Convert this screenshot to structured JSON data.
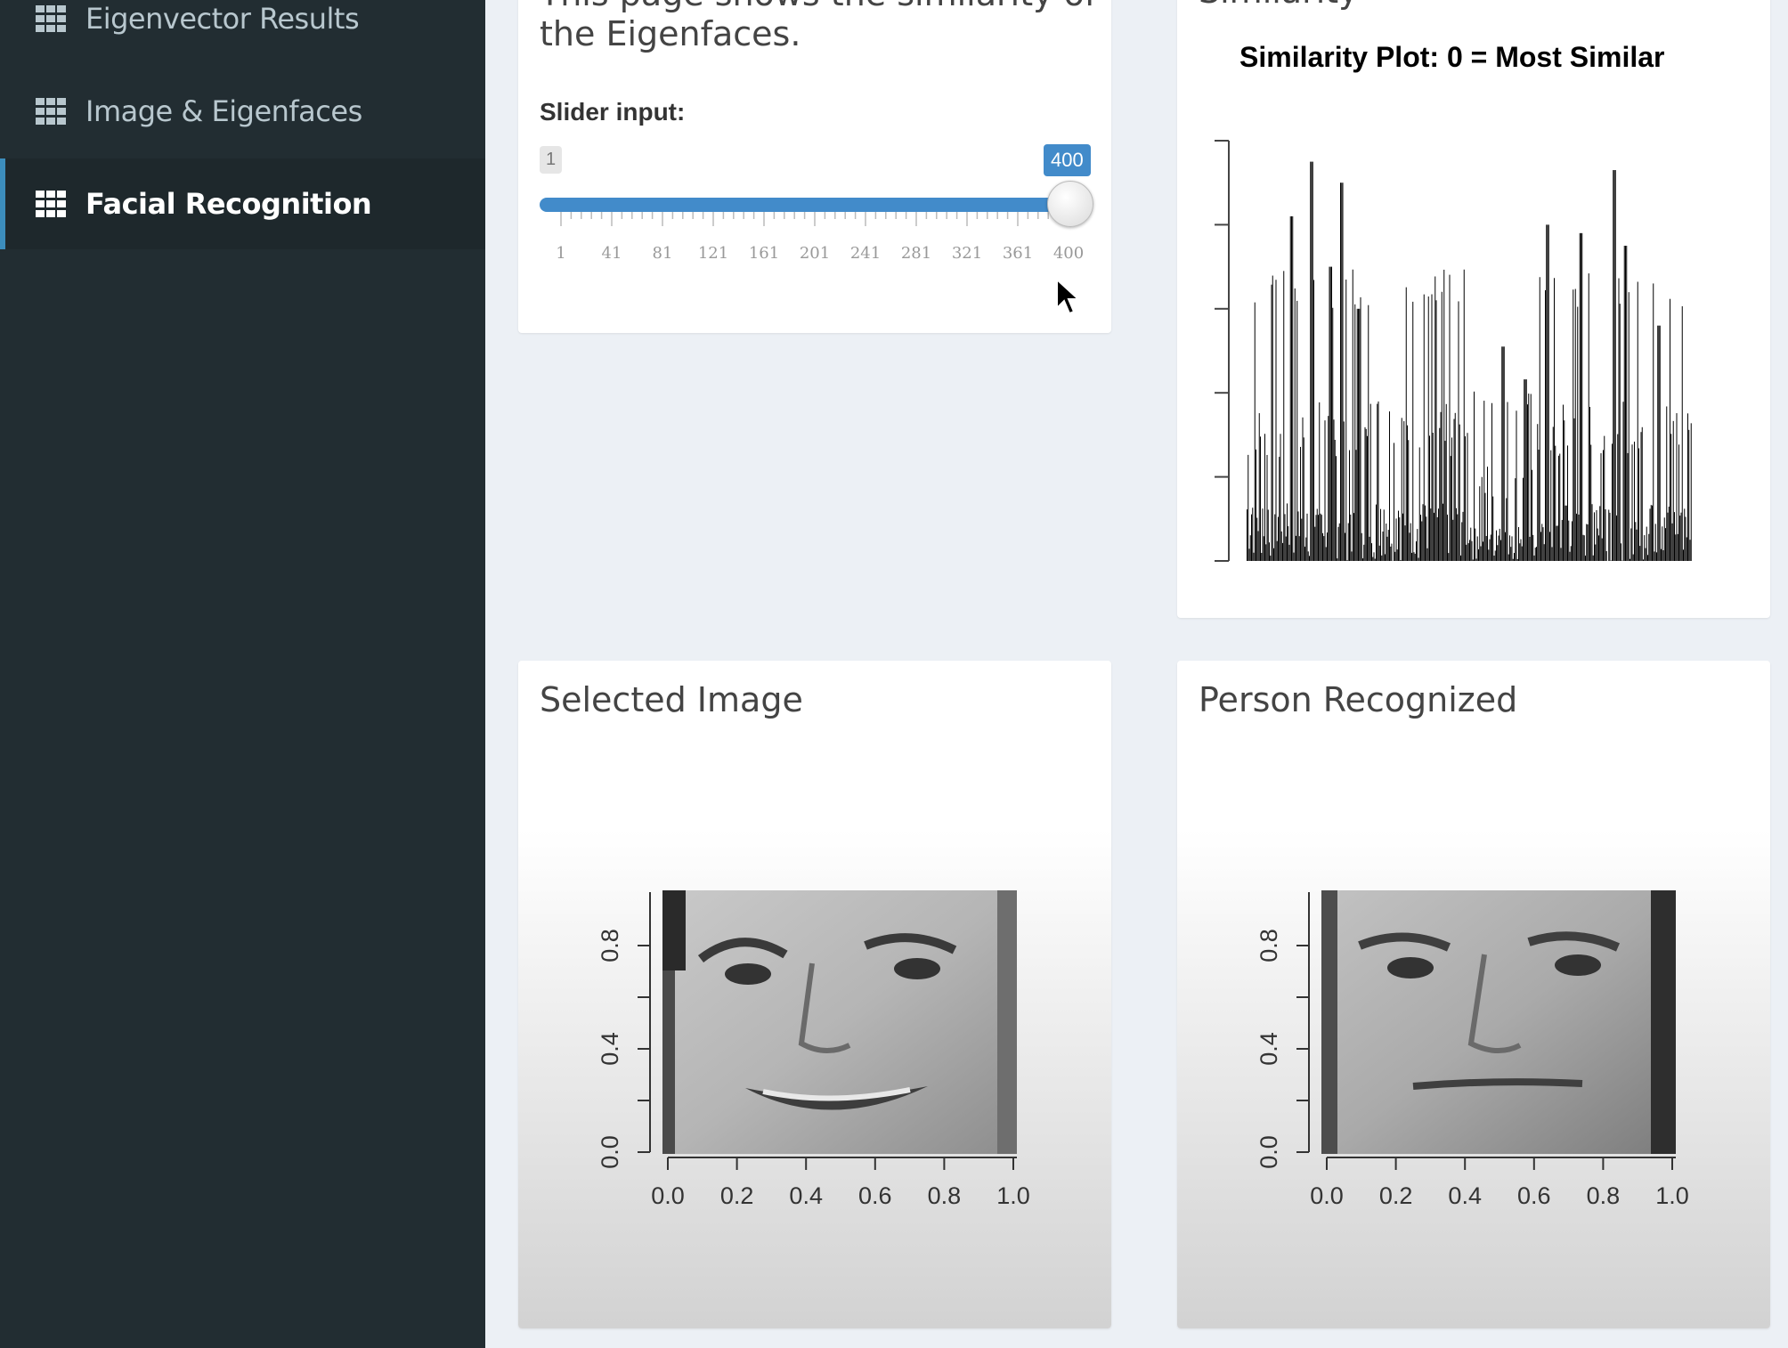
{
  "sidebar": {
    "items": [
      {
        "label": "Eigenvector Results",
        "icon": "grid-icon",
        "active": false
      },
      {
        "label": "Image & Eigenfaces",
        "icon": "grid-icon",
        "active": false
      },
      {
        "label": "Facial Recognition",
        "icon": "grid-icon",
        "active": true
      }
    ]
  },
  "similarity_box": {
    "description_line1": "This page shows the similarity of",
    "description_line2": "the Eigenfaces.",
    "slider": {
      "label": "Slider input:",
      "min": "1",
      "max": "400",
      "value": 400,
      "tick_labels": [
        "1",
        "41",
        "81",
        "121",
        "161",
        "201",
        "241",
        "281",
        "321",
        "361",
        "400"
      ]
    }
  },
  "similarity_plot": {
    "box_title": "Similarity",
    "title": "Similarity Plot: 0 = Most Similar"
  },
  "selected_image": {
    "title": "Selected Image",
    "x_ticks": [
      "0.0",
      "0.2",
      "0.4",
      "0.6",
      "0.8",
      "1.0"
    ],
    "y_ticks": [
      "0.0",
      "0.4",
      "0.8"
    ]
  },
  "person_recognized": {
    "title": "Person Recognized",
    "x_ticks": [
      "0.0",
      "0.2",
      "0.4",
      "0.6",
      "0.8",
      "1.0"
    ],
    "y_ticks": [
      "0.0",
      "0.4",
      "0.8"
    ]
  },
  "colors": {
    "sidebar_bg": "#222d32",
    "sidebar_active": "#1e282c",
    "accent": "#428bca",
    "page_bg": "#ecf0f5"
  }
}
